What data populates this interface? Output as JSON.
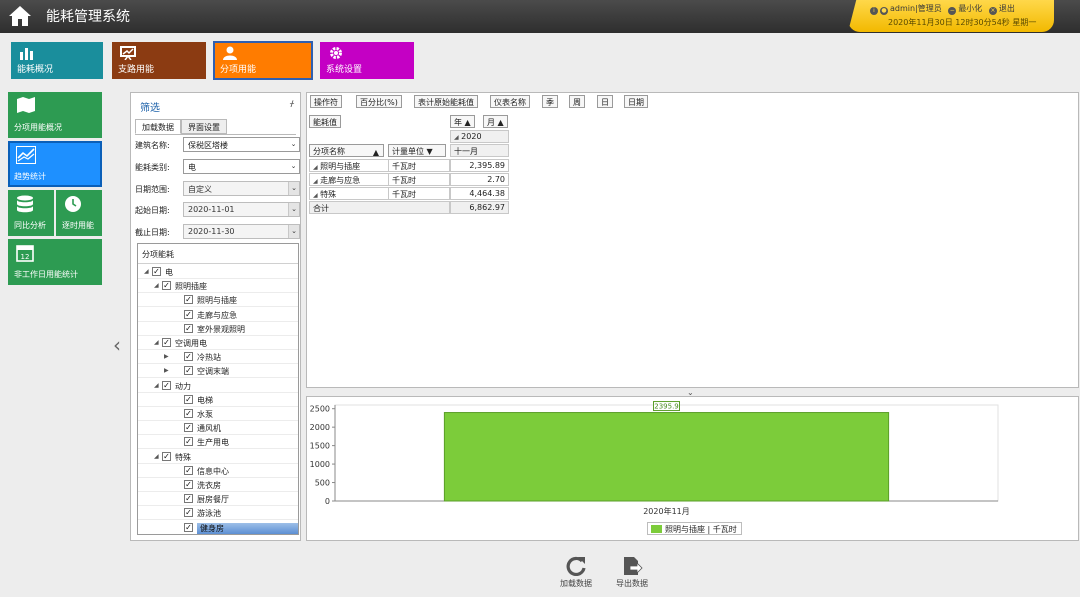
{
  "header": {
    "title": "能耗管理系统",
    "user": "admin|管理员",
    "minimize": "最小化",
    "logout": "退出",
    "datetime": "2020年11月30日 12时30分54秒 星期一"
  },
  "topnav": [
    "能耗概况",
    "支路用能",
    "分项用能",
    "系统设置"
  ],
  "sidenav": [
    "分项用能概况",
    "趋势统计",
    "同比分析",
    "逐时用能",
    "非工作日用能统计"
  ],
  "filter": {
    "title": "筛选",
    "tabs": [
      "加载数据",
      "界面设置"
    ],
    "building_label": "建筑名称:",
    "building_value": "保税区塔楼",
    "energy_label": "能耗类别:",
    "energy_value": "电",
    "range_label": "日期范围:",
    "range_value": "自定义",
    "start_label": "起始日期:",
    "start_value": "2020-11-01",
    "end_label": "截止日期:",
    "end_value": "2020-11-30",
    "tree_title": "分项能耗",
    "tree": [
      {
        "label": "电",
        "level": 0,
        "expand": "◢"
      },
      {
        "label": "照明插座",
        "level": 1,
        "expand": "◢"
      },
      {
        "label": "照明与插座",
        "level": 2,
        "expand": ""
      },
      {
        "label": "走廊与应急",
        "level": 2,
        "expand": ""
      },
      {
        "label": "室外景观照明",
        "level": 2,
        "expand": ""
      },
      {
        "label": "空调用电",
        "level": 1,
        "expand": "◢"
      },
      {
        "label": "冷热站",
        "level": 2,
        "expand": "▶"
      },
      {
        "label": "空调末端",
        "level": 2,
        "expand": "▶"
      },
      {
        "label": "动力",
        "level": 1,
        "expand": "◢"
      },
      {
        "label": "电梯",
        "level": 2,
        "expand": ""
      },
      {
        "label": "水泵",
        "level": 2,
        "expand": ""
      },
      {
        "label": "通风机",
        "level": 2,
        "expand": ""
      },
      {
        "label": "生产用电",
        "level": 2,
        "expand": ""
      },
      {
        "label": "特殊",
        "level": 1,
        "expand": "◢"
      },
      {
        "label": "信息中心",
        "level": 2,
        "expand": ""
      },
      {
        "label": "洗衣房",
        "level": 2,
        "expand": ""
      },
      {
        "label": "厨房餐厅",
        "level": 2,
        "expand": ""
      },
      {
        "label": "游泳池",
        "level": 2,
        "expand": ""
      },
      {
        "label": "健身房",
        "level": 2,
        "expand": "",
        "highlight": true
      }
    ]
  },
  "pivot": {
    "filter_fields": [
      "操作符",
      "百分比(%)",
      "表计原始能耗值",
      "仪表名称",
      "季",
      "周",
      "日",
      "日期"
    ],
    "data_field": "能耗值",
    "col_fields": [
      "年",
      "月"
    ],
    "year": "2020",
    "month": "十一月",
    "row_fields": [
      "分项名称",
      "计量单位"
    ],
    "rows": [
      {
        "name": "照明与插座",
        "unit": "千瓦时",
        "value": "2,395.89"
      },
      {
        "name": "走廊与应急",
        "unit": "千瓦时",
        "value": "2.70"
      },
      {
        "name": "特殊",
        "unit": "千瓦时",
        "value": "4,464.38"
      }
    ],
    "total_label": "合计",
    "total_value": "6,862.97"
  },
  "chart_data": {
    "type": "bar",
    "categories": [
      "2020年11月"
    ],
    "series": [
      {
        "name": "照明与插座 | 千瓦时",
        "values": [
          2395.9
        ],
        "color": "#7ccc3a"
      }
    ],
    "data_label": "2395.9",
    "y_ticks": [
      "0",
      "500",
      "1000",
      "1500",
      "2000",
      "2500"
    ],
    "ylim": [
      0,
      2600
    ],
    "legend_position": "bottom-center"
  },
  "footer": [
    "加载数据",
    "导出数据"
  ]
}
